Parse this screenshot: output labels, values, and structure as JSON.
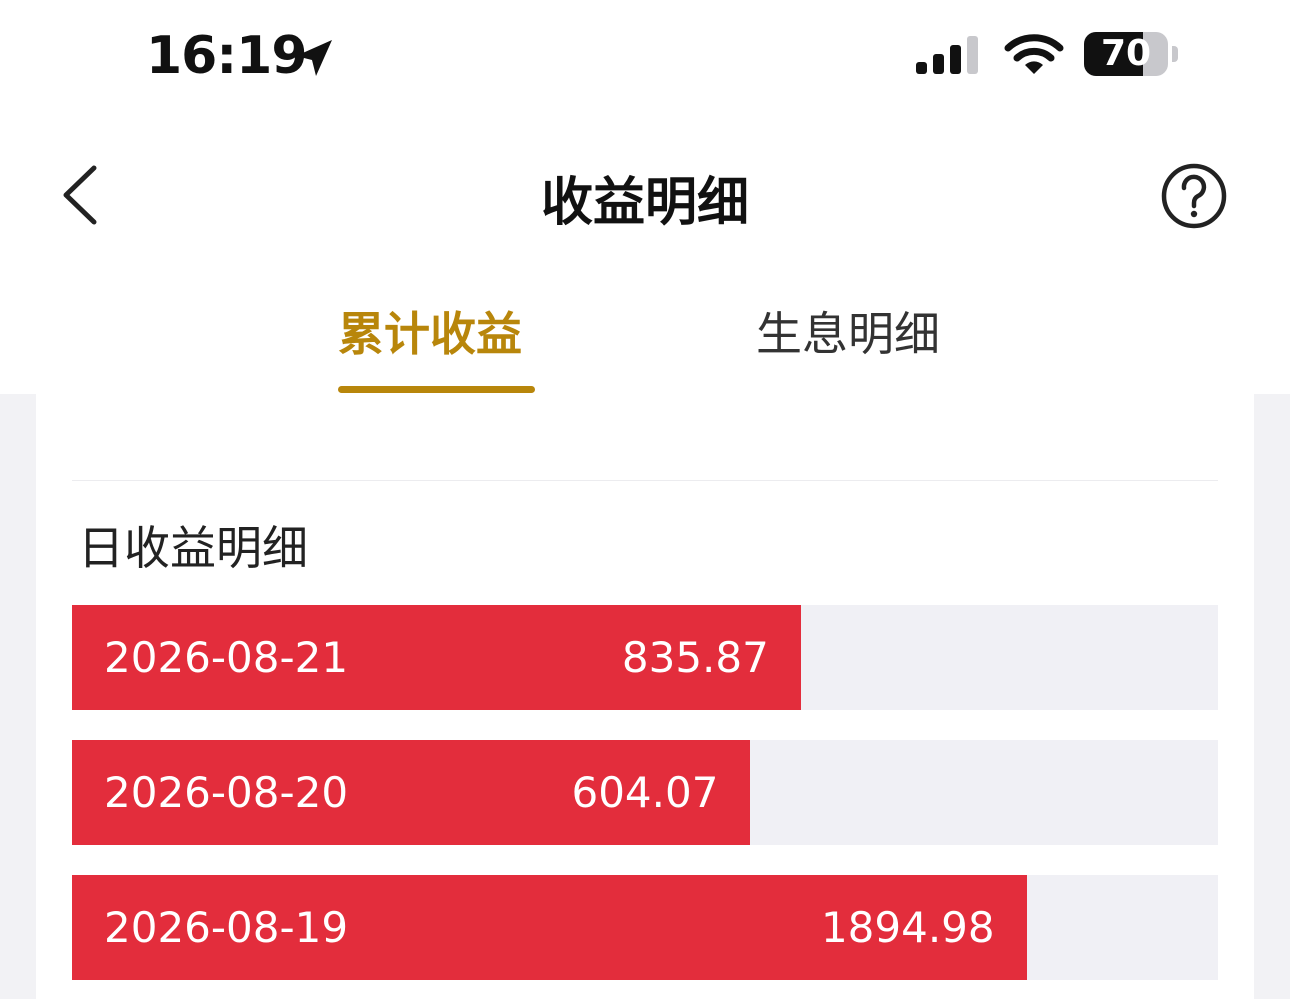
{
  "status_bar": {
    "time": "16:19",
    "battery": "70",
    "battery_level": 0.7
  },
  "nav": {
    "title": "收益明细"
  },
  "tabs": [
    {
      "label": "累计收益",
      "active": true
    },
    {
      "label": "生息明细",
      "active": false
    }
  ],
  "section": {
    "title": "日收益明细"
  },
  "colors": {
    "accent": "#b8860b",
    "bar": "#e32d3c",
    "track": "#f0f0f5"
  },
  "earnings": [
    {
      "date": "2026-08-21",
      "value": "835.87",
      "level": 0.636
    },
    {
      "date": "2026-08-20",
      "value": "604.07",
      "level": 0.592
    },
    {
      "date": "2026-08-19",
      "value": "1894.98",
      "level": 0.833
    }
  ]
}
